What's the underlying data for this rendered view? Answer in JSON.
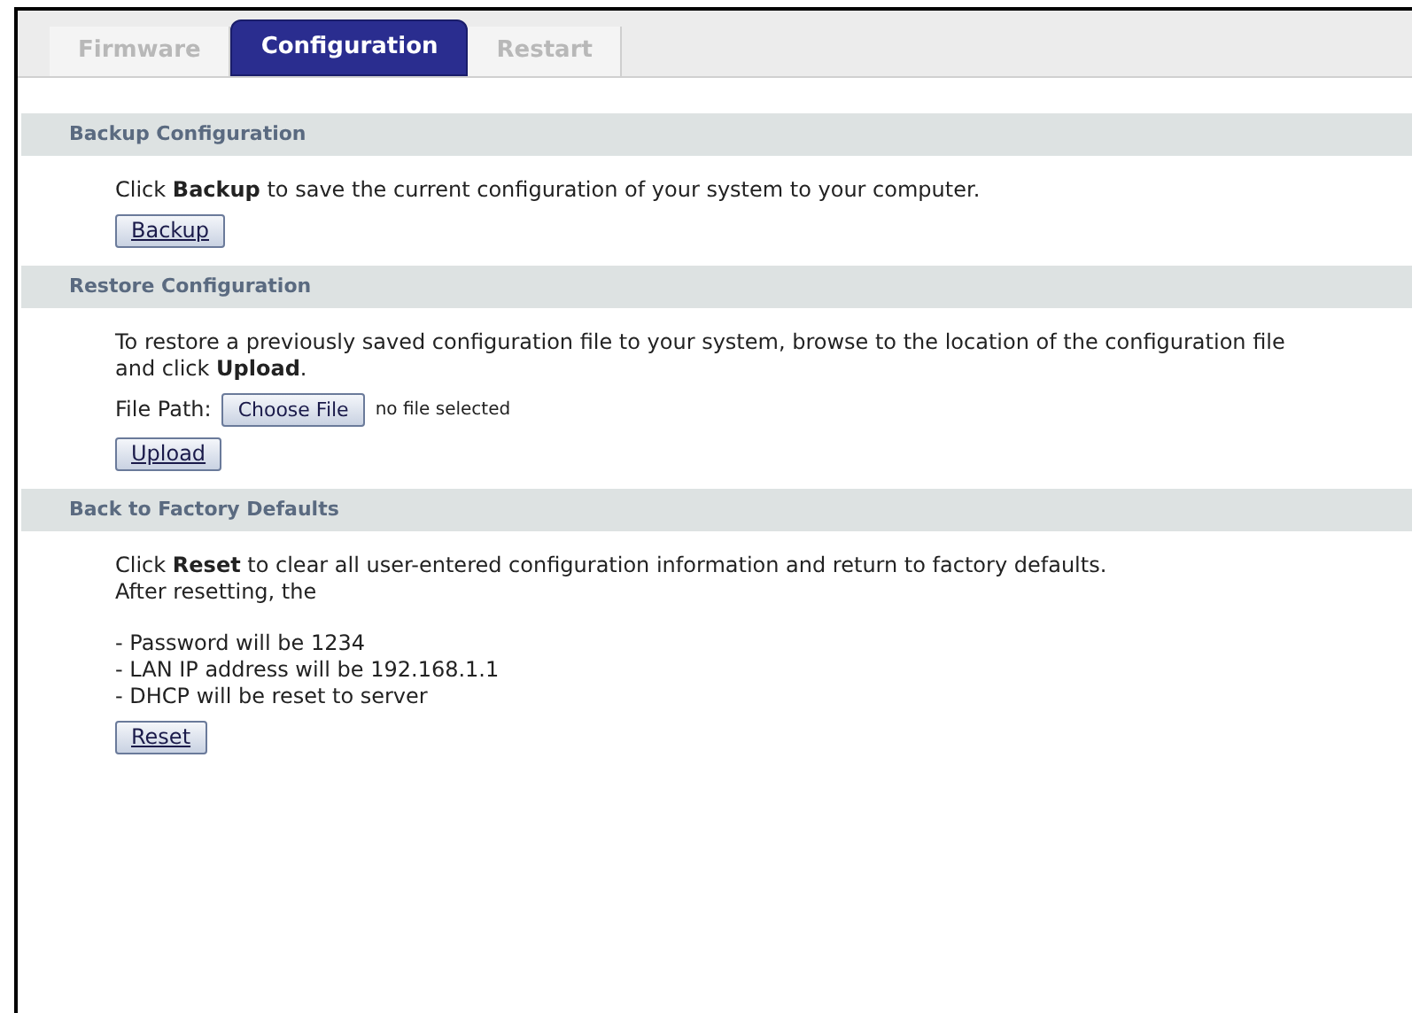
{
  "tabs": [
    {
      "label": "Firmware",
      "selected": false
    },
    {
      "label": "Configuration",
      "selected": true
    },
    {
      "label": "Restart",
      "selected": false
    }
  ],
  "sections": [
    {
      "title": "Backup Configuration",
      "paragraphs": [
        "Click **Backup** to save the current configuration of your system to your computer."
      ],
      "button": "Backup"
    },
    {
      "title": "Restore Configuration",
      "paragraphs": [
        "To restore a previously saved configuration file to your system, browse to the location of the configuration file and click **Upload**."
      ],
      "file_path": {
        "label": "File Path:",
        "button": "Choose File",
        "status": "no file selected"
      },
      "button": "Upload"
    },
    {
      "title": "Back to Factory Defaults",
      "paragraphs": [
        "Click **Reset** to clear all user-entered configuration information and return to factory defaults.",
        "After resetting, the"
      ],
      "list": [
        "- Password will be 1234",
        "- LAN IP address will be 192.168.1.1",
        "- DHCP will be reset to server"
      ],
      "button": "Reset"
    }
  ]
}
